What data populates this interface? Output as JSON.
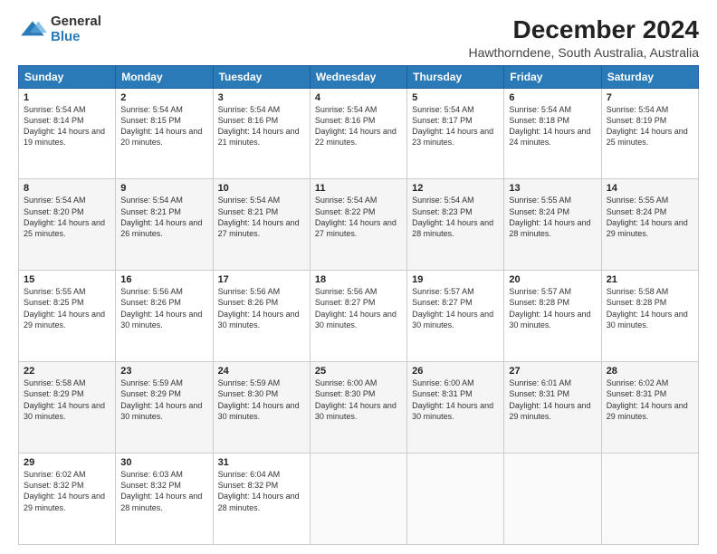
{
  "header": {
    "logo_general": "General",
    "logo_blue": "Blue",
    "title": "December 2024",
    "subtitle": "Hawthorndene, South Australia, Australia"
  },
  "weekdays": [
    "Sunday",
    "Monday",
    "Tuesday",
    "Wednesday",
    "Thursday",
    "Friday",
    "Saturday"
  ],
  "weeks": [
    [
      {
        "day": "1",
        "sunrise": "5:54 AM",
        "sunset": "8:14 PM",
        "daylight": "14 hours and 19 minutes."
      },
      {
        "day": "2",
        "sunrise": "5:54 AM",
        "sunset": "8:15 PM",
        "daylight": "14 hours and 20 minutes."
      },
      {
        "day": "3",
        "sunrise": "5:54 AM",
        "sunset": "8:16 PM",
        "daylight": "14 hours and 21 minutes."
      },
      {
        "day": "4",
        "sunrise": "5:54 AM",
        "sunset": "8:16 PM",
        "daylight": "14 hours and 22 minutes."
      },
      {
        "day": "5",
        "sunrise": "5:54 AM",
        "sunset": "8:17 PM",
        "daylight": "14 hours and 23 minutes."
      },
      {
        "day": "6",
        "sunrise": "5:54 AM",
        "sunset": "8:18 PM",
        "daylight": "14 hours and 24 minutes."
      },
      {
        "day": "7",
        "sunrise": "5:54 AM",
        "sunset": "8:19 PM",
        "daylight": "14 hours and 25 minutes."
      }
    ],
    [
      {
        "day": "8",
        "sunrise": "5:54 AM",
        "sunset": "8:20 PM",
        "daylight": "14 hours and 25 minutes."
      },
      {
        "day": "9",
        "sunrise": "5:54 AM",
        "sunset": "8:21 PM",
        "daylight": "14 hours and 26 minutes."
      },
      {
        "day": "10",
        "sunrise": "5:54 AM",
        "sunset": "8:21 PM",
        "daylight": "14 hours and 27 minutes."
      },
      {
        "day": "11",
        "sunrise": "5:54 AM",
        "sunset": "8:22 PM",
        "daylight": "14 hours and 27 minutes."
      },
      {
        "day": "12",
        "sunrise": "5:54 AM",
        "sunset": "8:23 PM",
        "daylight": "14 hours and 28 minutes."
      },
      {
        "day": "13",
        "sunrise": "5:55 AM",
        "sunset": "8:24 PM",
        "daylight": "14 hours and 28 minutes."
      },
      {
        "day": "14",
        "sunrise": "5:55 AM",
        "sunset": "8:24 PM",
        "daylight": "14 hours and 29 minutes."
      }
    ],
    [
      {
        "day": "15",
        "sunrise": "5:55 AM",
        "sunset": "8:25 PM",
        "daylight": "14 hours and 29 minutes."
      },
      {
        "day": "16",
        "sunrise": "5:56 AM",
        "sunset": "8:26 PM",
        "daylight": "14 hours and 30 minutes."
      },
      {
        "day": "17",
        "sunrise": "5:56 AM",
        "sunset": "8:26 PM",
        "daylight": "14 hours and 30 minutes."
      },
      {
        "day": "18",
        "sunrise": "5:56 AM",
        "sunset": "8:27 PM",
        "daylight": "14 hours and 30 minutes."
      },
      {
        "day": "19",
        "sunrise": "5:57 AM",
        "sunset": "8:27 PM",
        "daylight": "14 hours and 30 minutes."
      },
      {
        "day": "20",
        "sunrise": "5:57 AM",
        "sunset": "8:28 PM",
        "daylight": "14 hours and 30 minutes."
      },
      {
        "day": "21",
        "sunrise": "5:58 AM",
        "sunset": "8:28 PM",
        "daylight": "14 hours and 30 minutes."
      }
    ],
    [
      {
        "day": "22",
        "sunrise": "5:58 AM",
        "sunset": "8:29 PM",
        "daylight": "14 hours and 30 minutes."
      },
      {
        "day": "23",
        "sunrise": "5:59 AM",
        "sunset": "8:29 PM",
        "daylight": "14 hours and 30 minutes."
      },
      {
        "day": "24",
        "sunrise": "5:59 AM",
        "sunset": "8:30 PM",
        "daylight": "14 hours and 30 minutes."
      },
      {
        "day": "25",
        "sunrise": "6:00 AM",
        "sunset": "8:30 PM",
        "daylight": "14 hours and 30 minutes."
      },
      {
        "day": "26",
        "sunrise": "6:00 AM",
        "sunset": "8:31 PM",
        "daylight": "14 hours and 30 minutes."
      },
      {
        "day": "27",
        "sunrise": "6:01 AM",
        "sunset": "8:31 PM",
        "daylight": "14 hours and 29 minutes."
      },
      {
        "day": "28",
        "sunrise": "6:02 AM",
        "sunset": "8:31 PM",
        "daylight": "14 hours and 29 minutes."
      }
    ],
    [
      {
        "day": "29",
        "sunrise": "6:02 AM",
        "sunset": "8:32 PM",
        "daylight": "14 hours and 29 minutes."
      },
      {
        "day": "30",
        "sunrise": "6:03 AM",
        "sunset": "8:32 PM",
        "daylight": "14 hours and 28 minutes."
      },
      {
        "day": "31",
        "sunrise": "6:04 AM",
        "sunset": "8:32 PM",
        "daylight": "14 hours and 28 minutes."
      },
      null,
      null,
      null,
      null
    ]
  ]
}
